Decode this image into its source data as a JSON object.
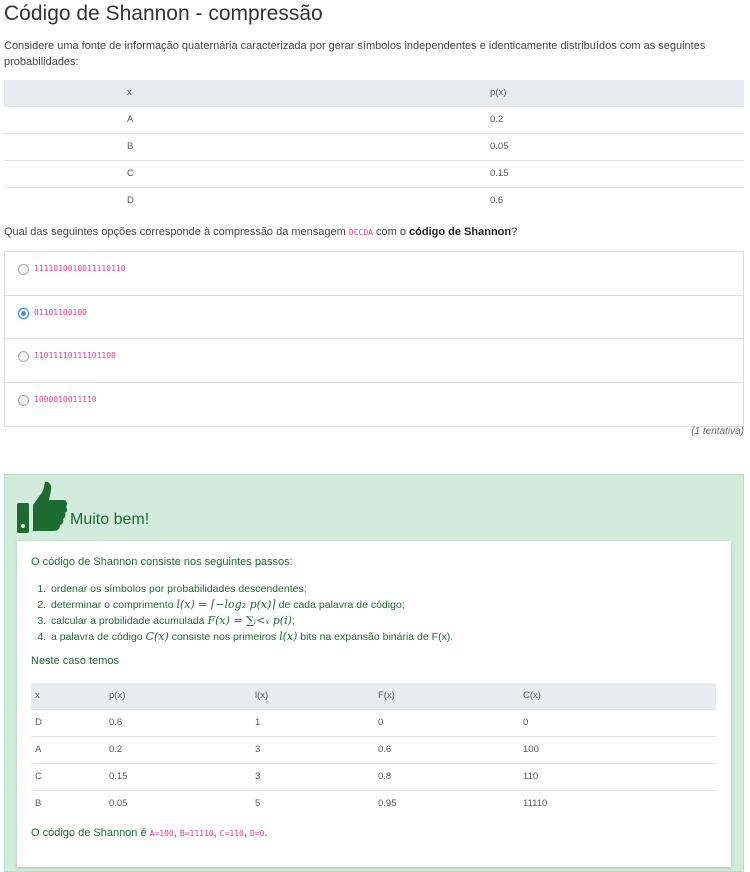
{
  "title": "Código de Shannon - compressão",
  "intro": "Considere uma fonte de informação quaternária caracterizada por gerar símbolos independentes e identicamente distribuídos com as seguintes probabilidades:",
  "prob_table": {
    "headers": [
      "x",
      "p(x)"
    ],
    "rows": [
      [
        "A",
        "0.2"
      ],
      [
        "B",
        "0.05"
      ],
      [
        "C",
        "0.15"
      ],
      [
        "D",
        "0.6"
      ]
    ]
  },
  "question": {
    "prefix": "Qual das seguintes opções corresponde à compressão da mensagem ",
    "message": "DCCDA",
    "middle": " com o ",
    "bold": "código de Shannon",
    "suffix": "?"
  },
  "options": [
    {
      "code": "1111010010011110110",
      "selected": false
    },
    {
      "code": "01101100100",
      "selected": true
    },
    {
      "code": "11011110111101100",
      "selected": false
    },
    {
      "code": "1000010011110",
      "selected": false
    }
  ],
  "attempts": "(1 tentativa)",
  "feedback": {
    "icon": "thumbs-up-icon",
    "title": "Muito bem!",
    "lead": "O código de Shannon consiste nos seguintes passos:",
    "steps": [
      {
        "a": "ordenar os símbolos por probabilidades descendentes;",
        "m1": "",
        "b": "",
        "m2": "",
        "c": ""
      },
      {
        "a": "determinar o comprimento ",
        "m1": "l(x) = ⌈−log₂ p(x)⌉",
        "b": " de cada palavra de código;",
        "m2": "",
        "c": ""
      },
      {
        "a": "calcular a probilidade acumulada ",
        "m1": "F(x) = ∑ᵢ<ₓ p(i)",
        "b": ";",
        "m2": "",
        "c": ""
      },
      {
        "a": "a palavra de código ",
        "m1": "C(x)",
        "b": " consiste nos primeiros ",
        "m2": "l(x)",
        "c": " bits na expansão binária de F(x)."
      }
    ],
    "caso": "Neste caso temos",
    "table": {
      "headers": [
        "x",
        "p(x)",
        "l(x)",
        "F(x)",
        "C(x)"
      ],
      "rows": [
        [
          "D",
          "0.6",
          "1",
          "0",
          "0"
        ],
        [
          "A",
          "0.2",
          "3",
          "0.6",
          "100"
        ],
        [
          "C",
          "0.15",
          "3",
          "0.8",
          "110"
        ],
        [
          "B",
          "0.05",
          "5",
          "0.95",
          "11110"
        ]
      ]
    },
    "final_prefix": "O código de Shannon é ",
    "final_codes": [
      "A=100",
      "B=11110",
      "C=110",
      "D=0"
    ],
    "final_sep": ", ",
    "final_suffix": "."
  },
  "colors": {
    "success_bg": "#d2ecdc",
    "success_text": "#1e6b32",
    "code": "#e83e8c"
  }
}
